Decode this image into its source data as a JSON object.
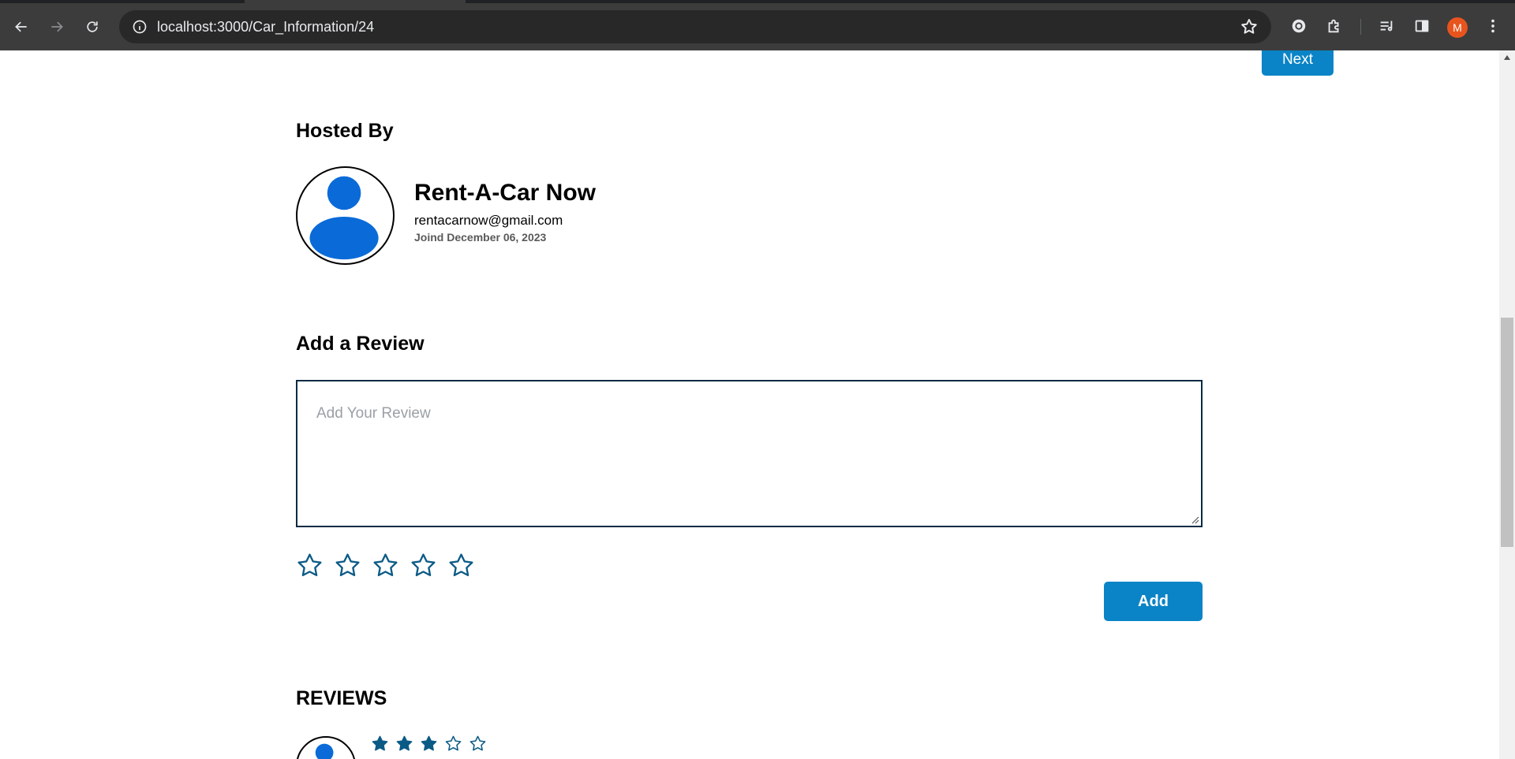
{
  "browser": {
    "url": "localhost:3000/Car_Information/24",
    "profile_initial": "M"
  },
  "page": {
    "next_label": "Next",
    "hosted_by": {
      "title": "Hosted By",
      "name": "Rent-A-Car Now",
      "email": "rentacarnow@gmail.com",
      "joined": "Joind December 06, 2023"
    },
    "add_review": {
      "title": "Add a Review",
      "placeholder": "Add Your Review",
      "rating": 0,
      "max_rating": 5,
      "add_label": "Add"
    },
    "reviews": {
      "title": "REVIEWS",
      "items": [
        {
          "rating": 3,
          "max_rating": 5
        }
      ]
    }
  },
  "colors": {
    "primary_button": "#0a84c6",
    "star": "#0b5a86",
    "avatar_blue": "#0a6bd8",
    "chrome_bg": "#3c3c3c"
  }
}
